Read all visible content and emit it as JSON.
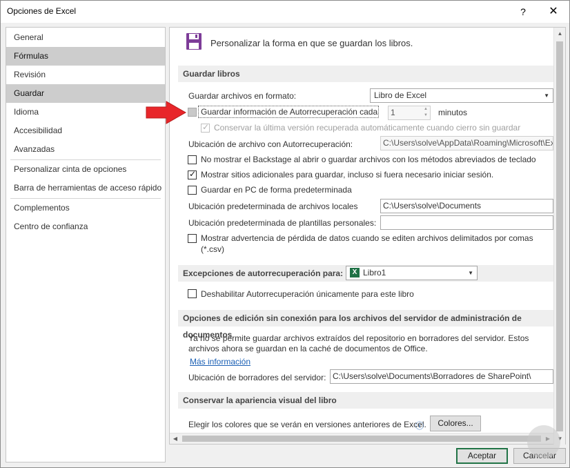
{
  "window": {
    "title": "Opciones de Excel",
    "help": "?",
    "close": "✕"
  },
  "sidebar": {
    "items": [
      {
        "label": "General"
      },
      {
        "label": "Fórmulas"
      },
      {
        "label": "Revisión"
      },
      {
        "label": "Guardar"
      },
      {
        "label": "Idioma"
      },
      {
        "label": "Accesibilidad"
      },
      {
        "label": "Avanzadas"
      },
      {
        "label": "Personalizar cinta de opciones"
      },
      {
        "label": "Barra de herramientas de acceso rápido"
      },
      {
        "label": "Complementos"
      },
      {
        "label": "Centro de confianza"
      }
    ],
    "selected": [
      "Fórmulas",
      "Guardar"
    ]
  },
  "main": {
    "header": "Personalizar la forma en que se guardan los libros.",
    "save": {
      "section_title": "Guardar libros",
      "format_label": "Guardar archivos en formato:",
      "format_value": "Libro de Excel",
      "autorecover_label": "Guardar información de Autorrecuperación cada",
      "autorecover_minutes": "1",
      "minutes_label": "minutos",
      "keep_last_label": "Conservar la última versión recuperada automáticamente cuando cierro sin guardar",
      "autorecover_location_label": "Ubicación de archivo con Autorrecuperación:",
      "autorecover_location_value": "C:\\Users\\solve\\AppData\\Roaming\\Microsoft\\Ex",
      "no_backstage_label": "No mostrar el Backstage al abrir o guardar archivos con los métodos abreviados de teclado",
      "show_additional_label": "Mostrar sitios adicionales para guardar, incluso si fuera necesario iniciar sesión.",
      "save_pc_default_label": "Guardar en PC de forma predeterminada",
      "local_location_label": "Ubicación predeterminada de archivos locales",
      "local_location_value": "C:\\Users\\solve\\Documents",
      "templates_location_label": "Ubicación predeterminada de plantillas personales:",
      "templates_location_value": "",
      "data_loss_label_1": "Mostrar advertencia de pérdida de datos cuando se editen archivos delimitados por comas",
      "data_loss_label_2": "(*.csv)"
    },
    "exceptions": {
      "section_title": "Excepciones de autorrecuperación para:",
      "workbook": "Libro1",
      "xl_letter": "X",
      "disable_label": "Deshabilitar Autorrecuperación únicamente para este libro"
    },
    "offline": {
      "section_title": "Opciones de edición sin conexión para los archivos del servidor de administración de documentos",
      "info_line1": "Ya no se permite guardar archivos extraídos del repositorio en borradores del servidor. Estos",
      "info_line2": "archivos ahora se guardan en la caché de documentos de Office.",
      "more_info": "Más información",
      "drafts_label": "Ubicación de borradores del servidor:",
      "drafts_value": "C:\\Users\\solve\\Documents\\Borradores de SharePoint\\"
    },
    "visual": {
      "section_title": "Conservar la apariencia visual del libro",
      "colors_label": "Elegir los colores que se verán en versiones anteriores de Excel.",
      "info_glyph": "ⓘ",
      "colors_button": "Colores..."
    }
  },
  "footer": {
    "ok": "Aceptar",
    "cancel": "Cancelar"
  },
  "colors": {
    "accent": "#217346",
    "arrow": "#e8262a",
    "selected": "#cdcdcd"
  }
}
